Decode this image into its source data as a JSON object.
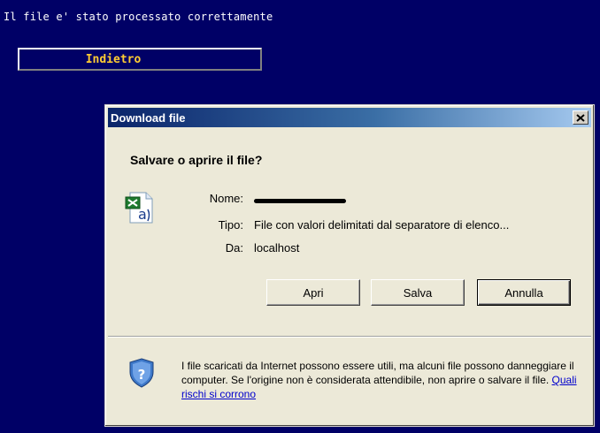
{
  "page": {
    "status_message": "Il file e' stato processato correttamente",
    "back_button_label": "Indietro"
  },
  "dialog": {
    "title": "Download file",
    "question": "Salvare o aprire il file?",
    "file_icon": "excel-csv-file-icon",
    "fields": {
      "name_label": "Nome:",
      "name_value": "",
      "type_label": "Tipo:",
      "type_value": "File con valori delimitati dal separatore di elenco...",
      "from_label": "Da:",
      "from_value": "localhost"
    },
    "buttons": {
      "open": "Apri",
      "save": "Salva",
      "cancel": "Annulla"
    },
    "warning": {
      "text": "I file scaricati da Internet possono essere utili, ma alcuni file possono danneggiare il computer. Se l'origine non è considerata attendibile, non aprire o salvare il file.",
      "link": "Quali rischi si corrono"
    },
    "close_icon": "close-icon",
    "shield_icon": "security-shield-icon"
  },
  "colors": {
    "page_background": "#000066",
    "back_button_text": "#ffcc33",
    "titlebar_start": "#0a246a",
    "titlebar_end": "#a6caf0",
    "dialog_background": "#ece9d8",
    "link": "#0000cc"
  }
}
